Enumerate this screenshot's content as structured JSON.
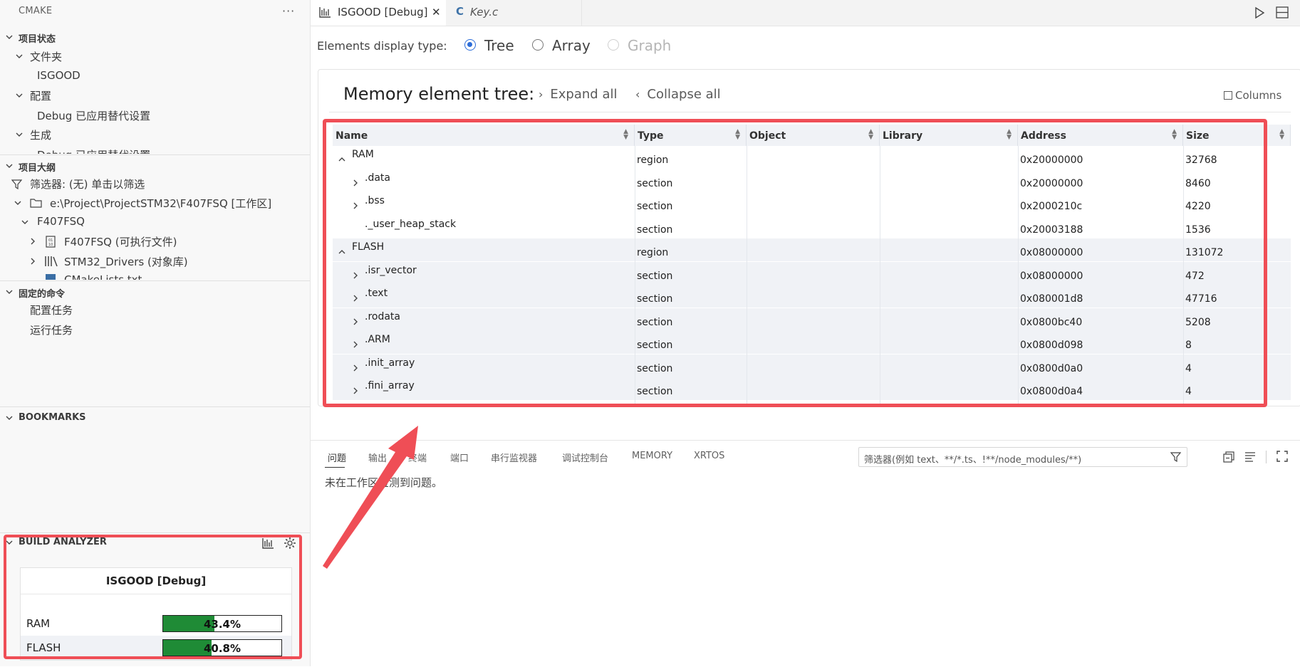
{
  "sidebar": {
    "header": "CMAKE",
    "more": "···",
    "project_status": {
      "title": "项目状态",
      "items": [
        {
          "label": "文件夹",
          "level": 1,
          "expanded": true
        },
        {
          "label": "ISGOOD",
          "level": 2
        },
        {
          "label": "配置",
          "level": 1,
          "expanded": true
        },
        {
          "label": "Debug  已应用替代设置",
          "level": 2
        },
        {
          "label": "生成",
          "level": 1,
          "expanded": true
        },
        {
          "label": "Debug  已应用替代设置",
          "level": 2
        }
      ]
    },
    "outline": {
      "title": "项目大纲",
      "filter": "筛选器: (无) 单击以筛选",
      "workspace": "e:\\Project\\ProjectSTM32\\F407FSQ  [工作区]",
      "project": "F407FSQ",
      "executable": "F407FSQ (可执行文件)",
      "library": "STM32_Drivers (对象库)",
      "cmakelists": "CMakeLists.txt"
    },
    "pinned": {
      "title": "固定的命令",
      "items": [
        "配置任务",
        "运行任务"
      ]
    },
    "bookmarks": {
      "title": "BOOKMARKS"
    },
    "build_analyzer": {
      "title": "BUILD ANALYZER",
      "table_title": "ISGOOD [Debug]",
      "rows": [
        {
          "name": "RAM",
          "percent_label": "43.4%",
          "fraction": 0.434
        },
        {
          "name": "FLASH",
          "percent_label": "40.8%",
          "fraction": 0.408
        }
      ]
    }
  },
  "tabs": [
    {
      "label": "ISGOOD [Debug]",
      "active": true,
      "close": "✕"
    },
    {
      "label": "Key.c",
      "active": false,
      "icon_text": "C"
    }
  ],
  "memory_view": {
    "display_type_label": "Elements display type:",
    "options": [
      {
        "label": "Tree",
        "selected": true,
        "disabled": false
      },
      {
        "label": "Array",
        "selected": false,
        "disabled": false
      },
      {
        "label": "Graph",
        "selected": false,
        "disabled": true
      }
    ],
    "title": "Memory element tree:",
    "expand_all": "Expand all",
    "collapse_all": "Collapse all",
    "columns": "Columns",
    "headers": [
      "Name",
      "Type",
      "Object",
      "Library",
      "Address",
      "Size"
    ],
    "rows": [
      {
        "name": "RAM",
        "level": 0,
        "chevron": "up",
        "type": "region",
        "object": "",
        "library": "",
        "address": "0x20000000",
        "size": "32768",
        "group": "ram"
      },
      {
        "name": ".data",
        "level": 1,
        "chevron": "right",
        "type": "section",
        "object": "",
        "library": "",
        "address": "0x20000000",
        "size": "8460",
        "group": "ram"
      },
      {
        "name": ".bss",
        "level": 1,
        "chevron": "right",
        "type": "section",
        "object": "",
        "library": "",
        "address": "0x2000210c",
        "size": "4220",
        "group": "ram"
      },
      {
        "name": "._user_heap_stack",
        "level": 1,
        "chevron": "",
        "type": "section",
        "object": "",
        "library": "",
        "address": "0x20003188",
        "size": "1536",
        "group": "ram"
      },
      {
        "name": "FLASH",
        "level": 0,
        "chevron": "up",
        "type": "region",
        "object": "",
        "library": "",
        "address": "0x08000000",
        "size": "131072",
        "group": "flash"
      },
      {
        "name": ".isr_vector",
        "level": 1,
        "chevron": "right",
        "type": "section",
        "object": "",
        "library": "",
        "address": "0x08000000",
        "size": "472",
        "group": "flash"
      },
      {
        "name": ".text",
        "level": 1,
        "chevron": "right",
        "type": "section",
        "object": "",
        "library": "",
        "address": "0x080001d8",
        "size": "47716",
        "group": "flash"
      },
      {
        "name": ".rodata",
        "level": 1,
        "chevron": "right",
        "type": "section",
        "object": "",
        "library": "",
        "address": "0x0800bc40",
        "size": "5208",
        "group": "flash"
      },
      {
        "name": ".ARM",
        "level": 1,
        "chevron": "right",
        "type": "section",
        "object": "",
        "library": "",
        "address": "0x0800d098",
        "size": "8",
        "group": "flash"
      },
      {
        "name": ".init_array",
        "level": 1,
        "chevron": "right",
        "type": "section",
        "object": "",
        "library": "",
        "address": "0x0800d0a0",
        "size": "4",
        "group": "flash"
      },
      {
        "name": ".fini_array",
        "level": 1,
        "chevron": "right",
        "type": "section",
        "object": "",
        "library": "",
        "address": "0x0800d0a4",
        "size": "4",
        "group": "flash"
      }
    ]
  },
  "panel": {
    "tabs": [
      "问题",
      "输出",
      "终端",
      "端口",
      "串行监视器",
      "调试控制台",
      "MEMORY",
      "XRTOS"
    ],
    "active_tab": "问题",
    "filter_placeholder": "筛选器(例如 text、**/*.ts、!**/node_modules/**)",
    "message": "未在工作区检测到问题。"
  },
  "colors": {
    "highlight": "#ef4e56",
    "bar_fill": "#1f8b36",
    "radio_selected": "#2d6dd8",
    "header_bg": "#f0f2f6"
  },
  "icons": [
    "chevron-down-icon",
    "chevron-right-icon",
    "filter-icon",
    "folder-icon",
    "binary-icon",
    "library-icon",
    "graph-icon",
    "gear-icon",
    "run-icon",
    "split-editor-icon",
    "close-icon",
    "columns-icon",
    "arrow-annotation"
  ]
}
